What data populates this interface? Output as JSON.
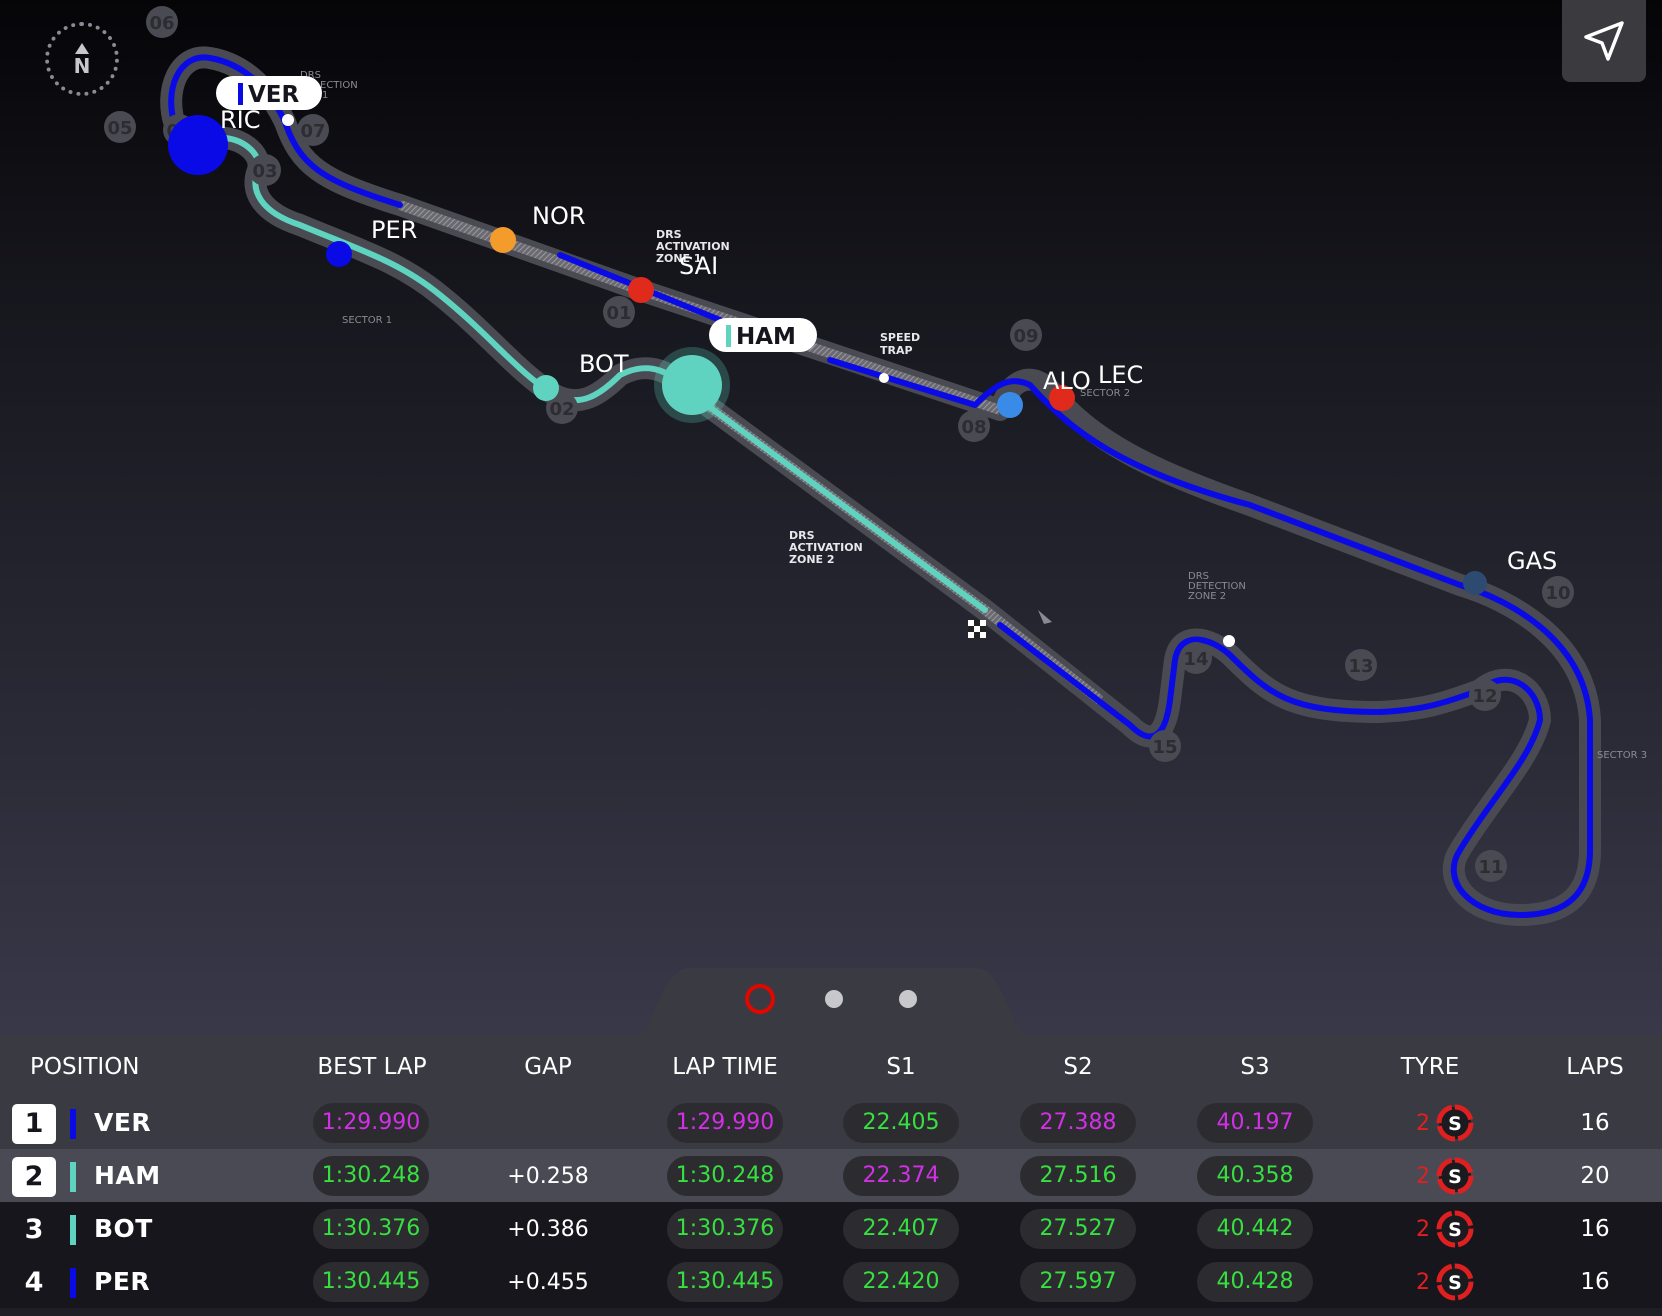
{
  "compass": {
    "label": "N"
  },
  "colors": {
    "red_bull": "#0a0ae6",
    "mercedes": "#5fd3bf",
    "ferrari": "#e02a1c",
    "mclaren": "#f39c2c",
    "alpine": "#3a8be8",
    "alphatauri": "#2d4a70",
    "purple": "#d230e6",
    "green": "#37e040",
    "tyre_soft": "#e02020"
  },
  "map": {
    "turns": [
      "01",
      "02",
      "03",
      "04",
      "05",
      "06",
      "07",
      "08",
      "09",
      "10",
      "11",
      "12",
      "13",
      "14",
      "15"
    ],
    "zone_labels": {
      "drs_detection_1a": "DRS",
      "drs_detection_1b": "ECTION",
      "drs_detection_1c": "1",
      "drs_activation_1a": "DRS",
      "drs_activation_1b": "ACTIVATION",
      "drs_activation_1c": "ZONE 1",
      "sector1": "SECTOR 1",
      "speed_trap_a": "SPEED",
      "speed_trap_b": "TRAP",
      "sector2": "SECTOR 2",
      "drs_activation_2a": "DRS",
      "drs_activation_2b": "ACTIVATION",
      "drs_activation_2c": "ZONE 2",
      "drs_detection_2a": "DRS",
      "drs_detection_2b": "DETECTION",
      "drs_detection_2c": "ZONE 2",
      "sector3": "SECTOR 3"
    },
    "drivers": {
      "ver": "VER",
      "ric": "RIC",
      "per": "PER",
      "nor": "NOR",
      "sai": "SAI",
      "ham": "HAM",
      "bot": "BOT",
      "alo": "ALO",
      "lec": "LEC",
      "gas": "GAS"
    }
  },
  "pager": {
    "pages": 3,
    "active": 0
  },
  "table": {
    "headers": {
      "position": "POSITION",
      "best_lap": "BEST LAP",
      "gap": "GAP",
      "lap_time": "LAP TIME",
      "s1": "S1",
      "s2": "S2",
      "s3": "S3",
      "tyre": "TYRE",
      "laps": "LAPS"
    },
    "rows": [
      {
        "pos": "1",
        "driver": "VER",
        "team_color": "#0a0ae6",
        "best_lap": "1:29.990",
        "gap": "",
        "lap_time": "1:29.990",
        "s1": "22.405",
        "s2": "27.388",
        "s3": "40.197",
        "tyre_age": "2",
        "tyre": "S",
        "laps": "16"
      },
      {
        "pos": "2",
        "driver": "HAM",
        "team_color": "#5fd3bf",
        "best_lap": "1:30.248",
        "gap": "+0.258",
        "lap_time": "1:30.248",
        "s1": "22.374",
        "s2": "27.516",
        "s3": "40.358",
        "tyre_age": "2",
        "tyre": "S",
        "laps": "20"
      },
      {
        "pos": "3",
        "driver": "BOT",
        "team_color": "#5fd3bf",
        "best_lap": "1:30.376",
        "gap": "+0.386",
        "lap_time": "1:30.376",
        "s1": "22.407",
        "s2": "27.527",
        "s3": "40.442",
        "tyre_age": "2",
        "tyre": "S",
        "laps": "16"
      },
      {
        "pos": "4",
        "driver": "PER",
        "team_color": "#0a0ae6",
        "best_lap": "1:30.445",
        "gap": "+0.455",
        "lap_time": "1:30.445",
        "s1": "22.420",
        "s2": "27.597",
        "s3": "40.428",
        "tyre_age": "2",
        "tyre": "S",
        "laps": "16"
      }
    ]
  }
}
